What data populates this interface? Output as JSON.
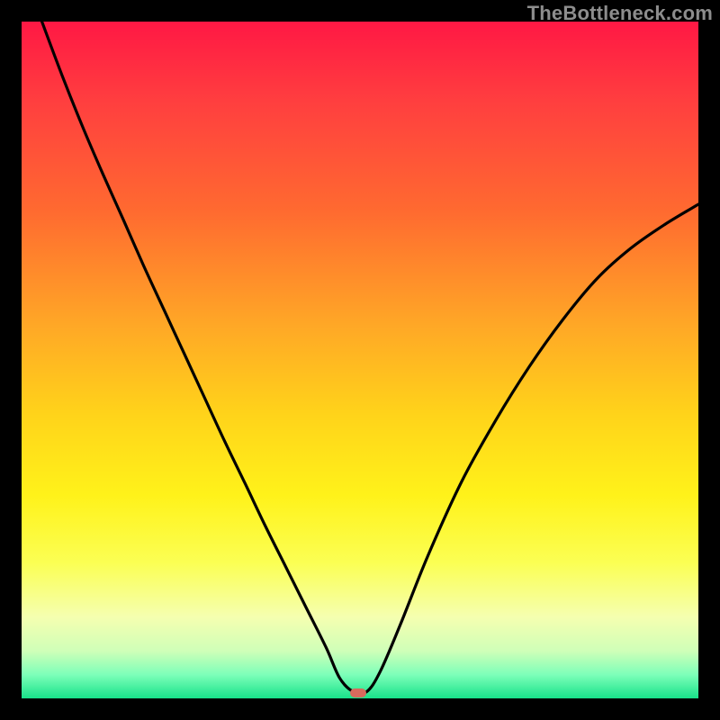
{
  "watermark": "TheBottleneck.com",
  "marker": {
    "x_frac": 0.498,
    "y_frac": 0.992,
    "color": "#d76a5d"
  },
  "chart_data": {
    "type": "line",
    "title": "",
    "xlabel": "",
    "ylabel": "",
    "xlim": [
      0,
      1
    ],
    "ylim": [
      0,
      1
    ],
    "grid": false,
    "annotations": [
      "TheBottleneck.com"
    ],
    "curve_description": "V-shaped curve descending steeply from upper-left, flattening briefly at the bottom near x≈0.47–0.52, then rising with decreasing slope toward the upper-right edge (reaching ≈0.73 height at x=1). Background is a vertical rainbow gradient from red (top) through orange, yellow, pale yellow to green (bottom).",
    "series": [
      {
        "name": "curve",
        "x": [
          0.03,
          0.06,
          0.09,
          0.12,
          0.15,
          0.18,
          0.21,
          0.24,
          0.27,
          0.3,
          0.33,
          0.36,
          0.39,
          0.42,
          0.45,
          0.47,
          0.49,
          0.51,
          0.53,
          0.56,
          0.6,
          0.65,
          0.7,
          0.75,
          0.8,
          0.85,
          0.9,
          0.95,
          1.0
        ],
        "y": [
          1.0,
          0.92,
          0.845,
          0.775,
          0.708,
          0.64,
          0.575,
          0.51,
          0.445,
          0.38,
          0.318,
          0.255,
          0.195,
          0.135,
          0.075,
          0.03,
          0.01,
          0.01,
          0.04,
          0.11,
          0.21,
          0.32,
          0.41,
          0.49,
          0.56,
          0.62,
          0.665,
          0.7,
          0.73
        ]
      }
    ],
    "gradient_stops": [
      {
        "pos": 0.0,
        "color": "#ff1844"
      },
      {
        "pos": 0.12,
        "color": "#ff3f3f"
      },
      {
        "pos": 0.28,
        "color": "#ff6a30"
      },
      {
        "pos": 0.45,
        "color": "#ffa826"
      },
      {
        "pos": 0.58,
        "color": "#ffd31a"
      },
      {
        "pos": 0.7,
        "color": "#fff21a"
      },
      {
        "pos": 0.8,
        "color": "#fbff54"
      },
      {
        "pos": 0.88,
        "color": "#f5ffb0"
      },
      {
        "pos": 0.93,
        "color": "#cfffb8"
      },
      {
        "pos": 0.965,
        "color": "#7dffb9"
      },
      {
        "pos": 1.0,
        "color": "#18e28a"
      }
    ]
  }
}
